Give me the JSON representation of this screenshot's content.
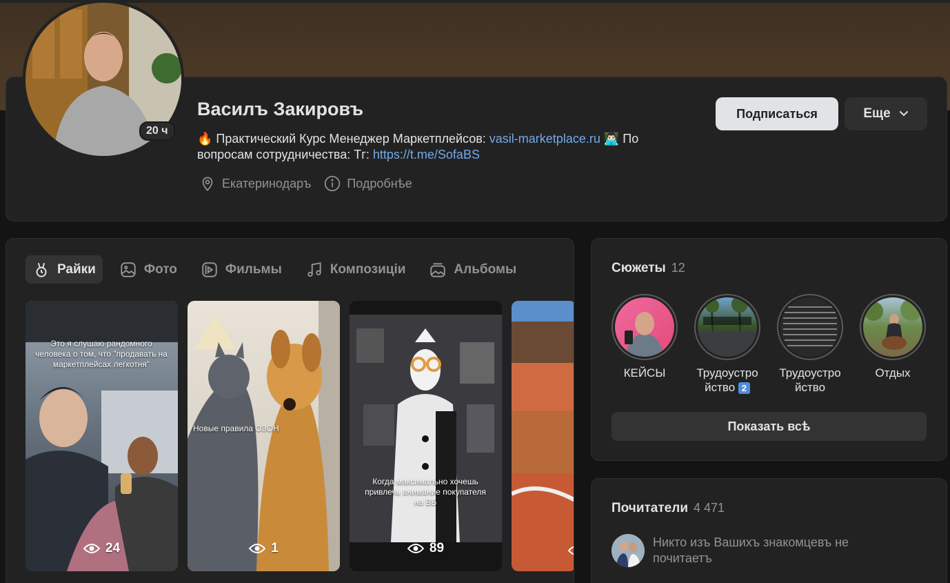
{
  "profile": {
    "name": "Василъ Закировъ",
    "story_badge": "20 ч",
    "bio_prefix": "🔥 Практический Курс Менеджер Маркетплейсов: ",
    "bio_link1": "vasil-marketplace.ru",
    "bio_middle": " 👨🏻‍💻 По вопросам сотрудничества: Тг: ",
    "bio_link2": "https://t.me/SofaBS",
    "location": "Екатеринодаръ",
    "details": "Подробнѣе",
    "subscribe_label": "Подписаться",
    "more_label": "Еще"
  },
  "tabs": [
    {
      "label": "Райки",
      "icon": "clips-icon",
      "active": true
    },
    {
      "label": "Фото",
      "icon": "photo-icon"
    },
    {
      "label": "Фильмы",
      "icon": "video-icon"
    },
    {
      "label": "Композиціи",
      "icon": "music-icon"
    },
    {
      "label": "Альбомы",
      "icon": "albums-icon"
    }
  ],
  "clips": [
    {
      "views": "24",
      "caption": "Это я слушаю рандомного человека о том, что \"продавать на маркетплейсах легкотня\""
    },
    {
      "views": "1",
      "caption": "Новые правила ОЗОН"
    },
    {
      "views": "89",
      "caption": "Когда максимально хочешь привлечь внимание покупателя на ВБ"
    },
    {
      "views": ""
    }
  ],
  "stories_section": {
    "title": "Сюжеты",
    "count": "12",
    "items": [
      {
        "label": "КЕЙСЫ"
      },
      {
        "label": "Трудоустро йство",
        "badge": "2"
      },
      {
        "label": "Трудоустро йство"
      },
      {
        "label": "Отдых"
      }
    ],
    "show_all_label": "Показать всѣ"
  },
  "fans_section": {
    "title": "Почитатели",
    "count": "4 471",
    "text": "Никто изъ Вашихъ знакомцевъ не почитаетъ"
  },
  "colors": {
    "background": "#141414",
    "card": "#222222",
    "link": "#71aaeb",
    "muted": "#939393",
    "primary_button": "#e1e3e6"
  }
}
